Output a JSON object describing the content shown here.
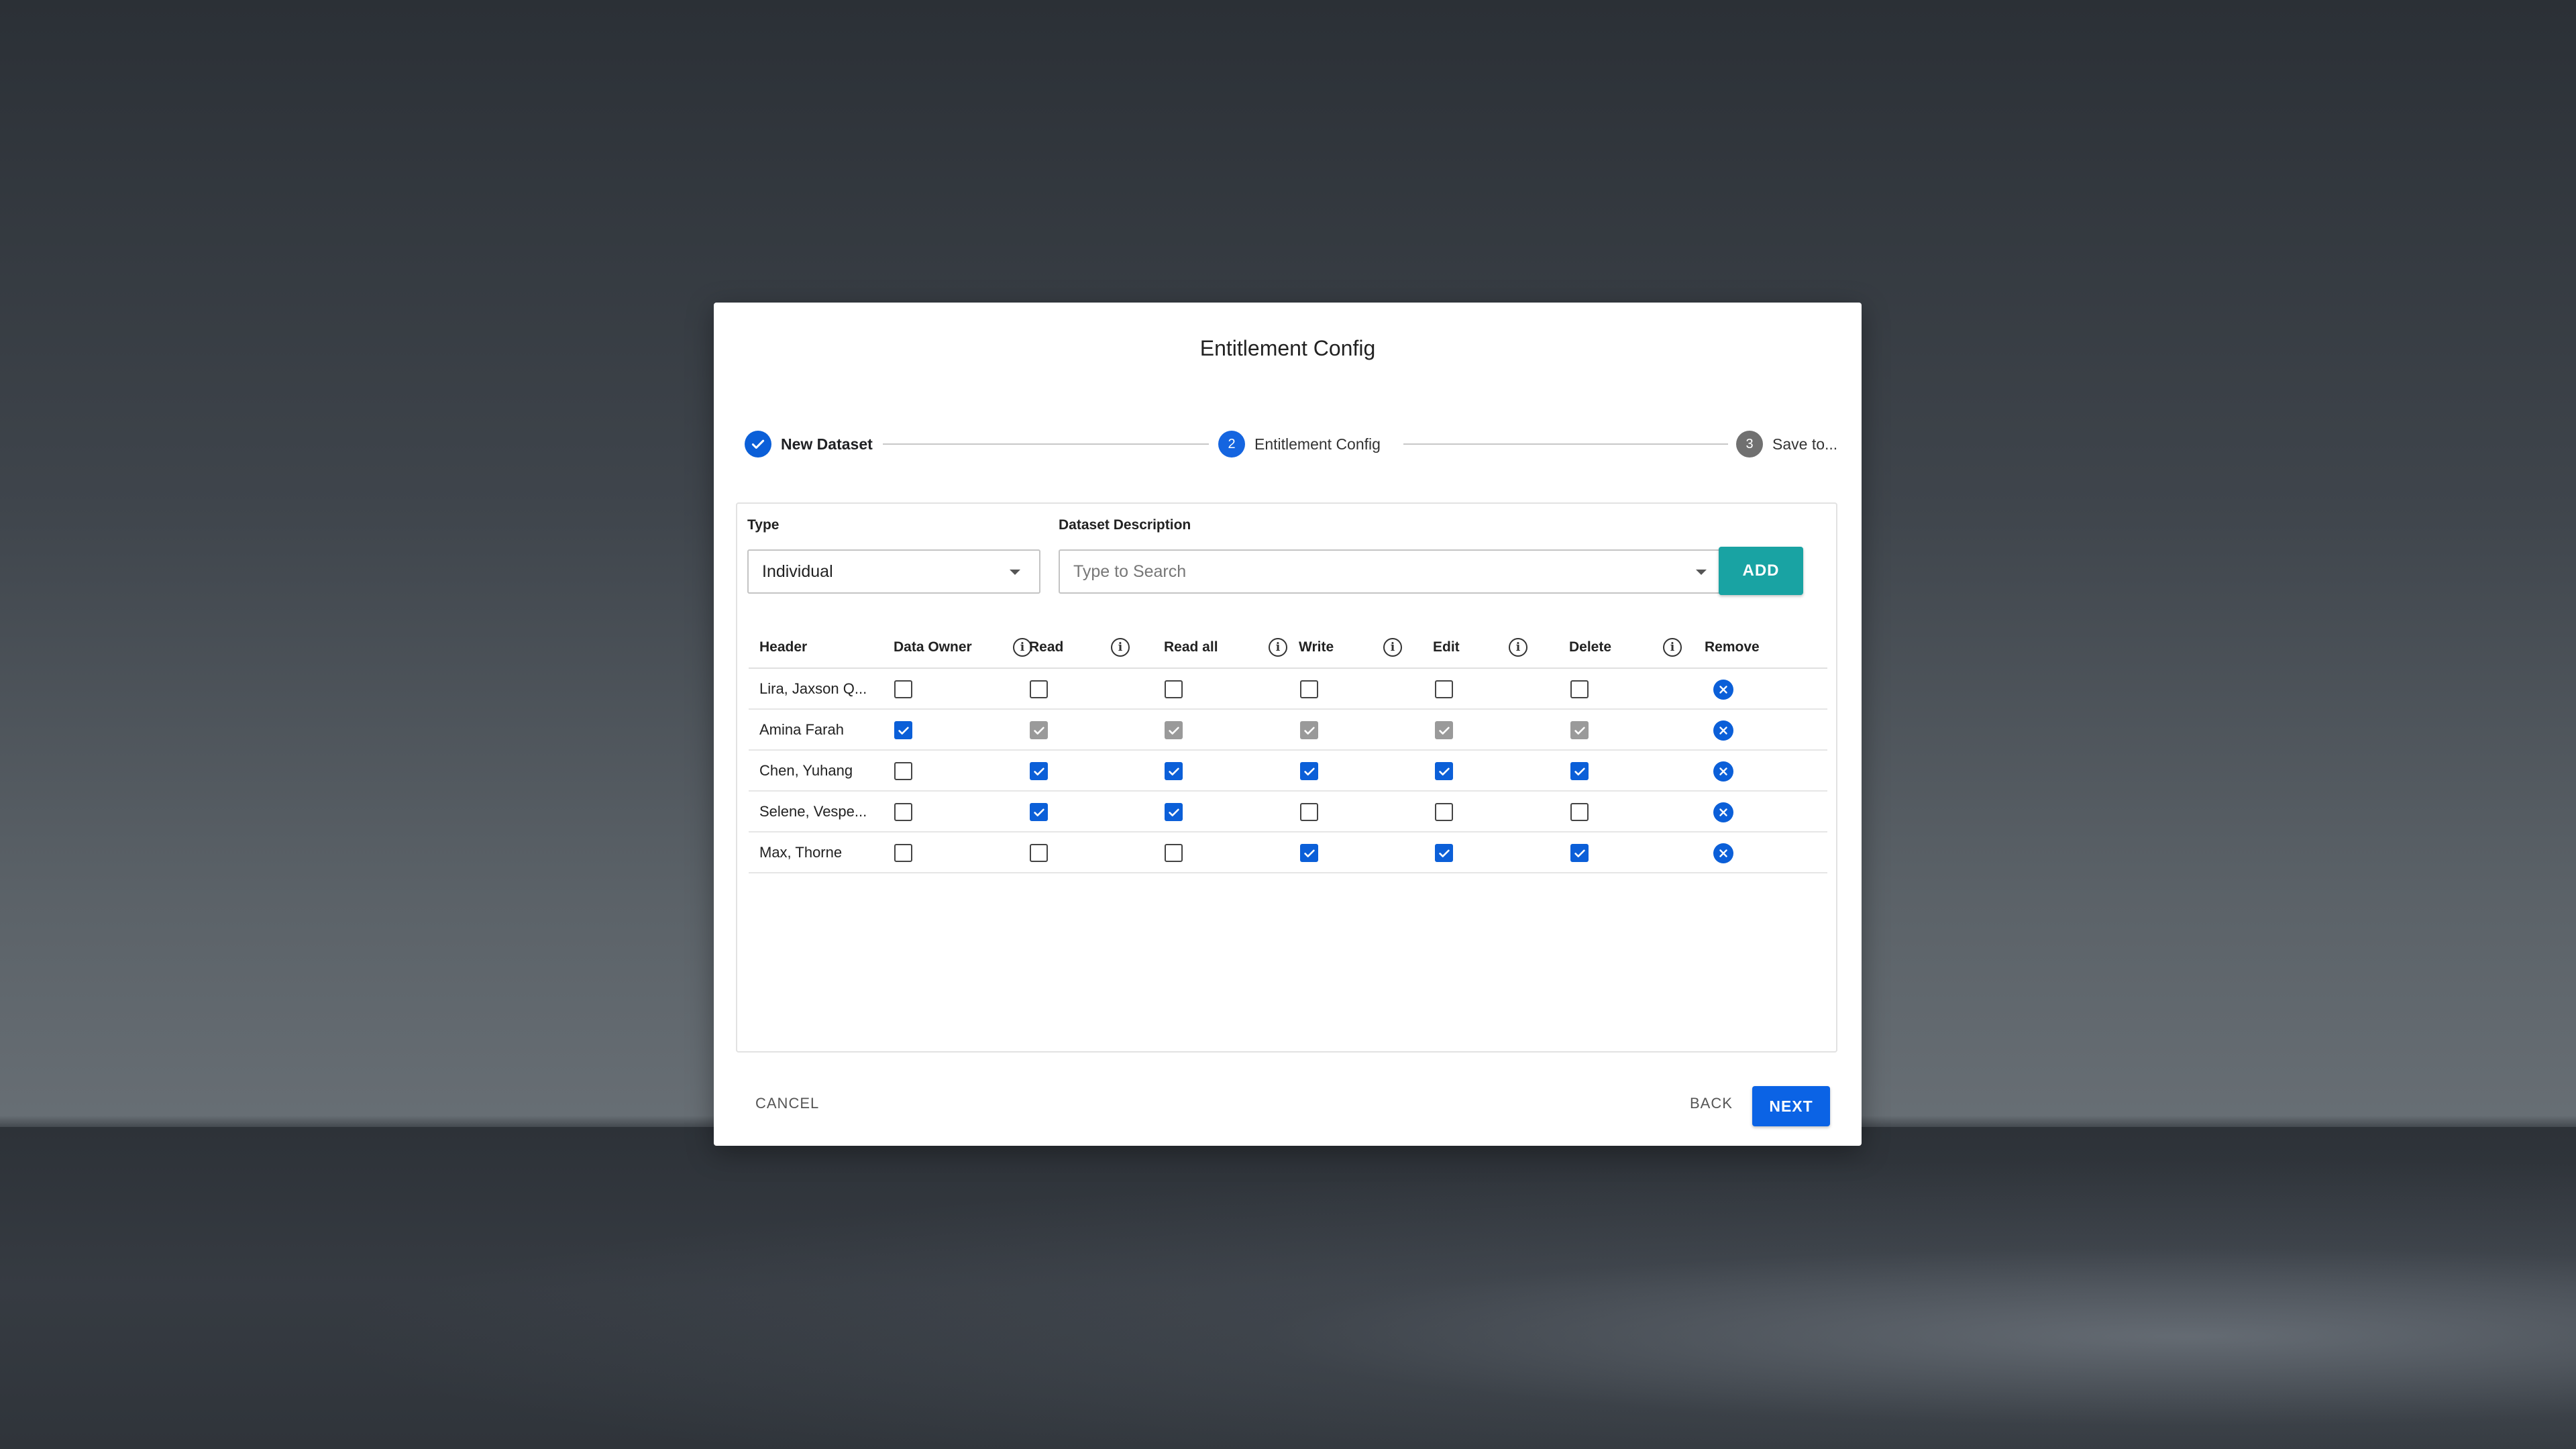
{
  "dialog": {
    "title": "Entitlement Config"
  },
  "stepper": {
    "steps": [
      {
        "label": "New Dataset",
        "state": "done",
        "icon": "check-icon"
      },
      {
        "label": "Entitlement Config",
        "state": "active",
        "number": "2"
      },
      {
        "label": "Save to...",
        "state": "pending",
        "number": "3"
      }
    ]
  },
  "form": {
    "type_label": "Type",
    "type_value": "Individual",
    "description_label": "Dataset Description",
    "description_placeholder": "Type to Search",
    "add_label": "ADD"
  },
  "table": {
    "columns": [
      "Header",
      "Data Owner",
      "Read",
      "Read all",
      "Write",
      "Edit",
      "Delete",
      "Remove"
    ],
    "rows": [
      {
        "name": "Lira, Jaxson Q...",
        "perms": [
          "off",
          "off",
          "off",
          "off",
          "off",
          "off"
        ]
      },
      {
        "name": "Amina Farah",
        "perms": [
          "on",
          "dis",
          "dis",
          "dis",
          "dis",
          "dis"
        ]
      },
      {
        "name": "Chen, Yuhang",
        "perms": [
          "off",
          "on",
          "on",
          "on",
          "on",
          "on"
        ]
      },
      {
        "name": "Selene, Vespe...",
        "perms": [
          "off",
          "on",
          "on",
          "off",
          "off",
          "off"
        ]
      },
      {
        "name": "Max, Thorne",
        "perms": [
          "off",
          "off",
          "off",
          "on",
          "on",
          "on"
        ]
      }
    ]
  },
  "footer": {
    "cancel_label": "CANCEL",
    "back_label": "BACK",
    "next_label": "NEXT"
  },
  "colors": {
    "primary": "#0b5fd8",
    "accent_teal": "#19a3a3",
    "disabled_gray": "#9a9a9a"
  }
}
